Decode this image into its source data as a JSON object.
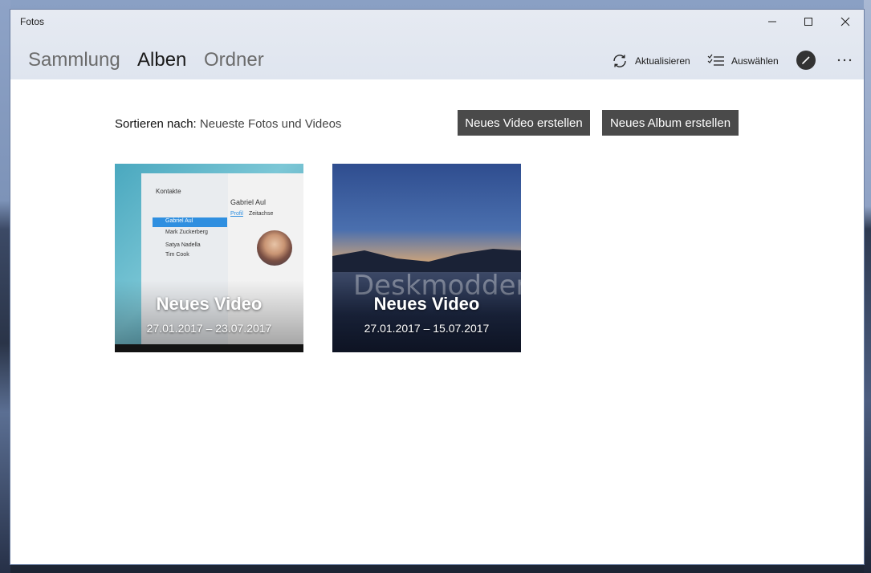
{
  "window": {
    "title": "Fotos"
  },
  "nav": {
    "tabs": [
      {
        "label": "Sammlung"
      },
      {
        "label": "Alben"
      },
      {
        "label": "Ordner"
      }
    ],
    "active_tab": "Alben"
  },
  "toolbar": {
    "refresh_label": "Aktualisieren",
    "select_label": "Auswählen"
  },
  "sort": {
    "label": "Sortieren nach:",
    "value": "Neueste Fotos und Videos"
  },
  "buttons": {
    "new_video": "Neues Video erstellen",
    "new_album": "Neues Album erstellen"
  },
  "albums": [
    {
      "title": "Neues Video",
      "dates": "27.01.2017 – 23.07.2017"
    },
    {
      "title": "Neues Video",
      "dates": "27.01.2017 – 15.07.2017"
    }
  ],
  "thumbnail1": {
    "header": "Kontakte",
    "contact_name": "Gabriel Aul",
    "tab_profile": "Profil",
    "tab_timeline": "Zeitachse",
    "list": [
      "Gabriel Aul",
      "Mark Zuckerberg",
      "Satya Nadella",
      "Tim Cook"
    ]
  },
  "thumbnail2": {
    "watermark": "Deskmodder.de"
  },
  "colors": {
    "button_bg": "#4a4a4a",
    "titlebar_bg": "#e2e7f0",
    "accent_blue": "#2f8fe0"
  }
}
